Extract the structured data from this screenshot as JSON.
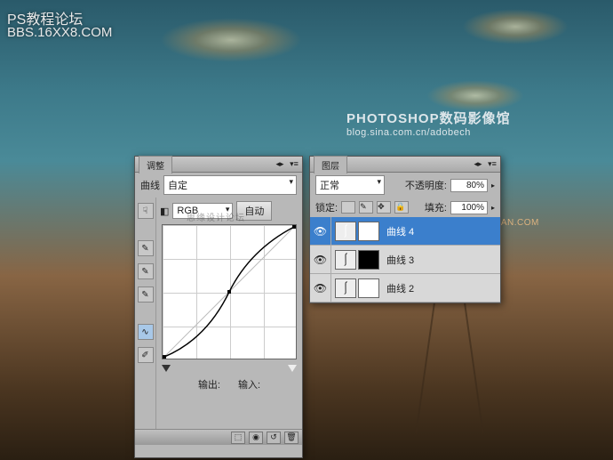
{
  "watermark": {
    "line1_a": "PS",
    "line1_b": "教程论坛",
    "line2_a": "BBS.16",
    "line2_b": "XX",
    "line2_c": "8.COM"
  },
  "centerlogo": {
    "line1": "PHOTOSHOP数码影像馆",
    "line2": "blog.sina.com.cn/adobech"
  },
  "missyuan": "WWW.MISSYUAN.COM",
  "faint_wm": "思缘设计论坛",
  "adjustments": {
    "panel_title": "调整",
    "type_label": "曲线",
    "preset": "自定",
    "channel": "RGB",
    "auto_btn": "自动",
    "output_label": "输出:",
    "input_label": "输入:"
  },
  "layers": {
    "panel_title": "图层",
    "blend_mode": "正常",
    "opacity_label": "不透明度:",
    "opacity_value": "80%",
    "lock_label": "锁定:",
    "fill_label": "填充:",
    "fill_value": "100%",
    "items": [
      {
        "name": "曲线 4",
        "mask": "white",
        "selected": true
      },
      {
        "name": "曲线 3",
        "mask": "black",
        "selected": false
      },
      {
        "name": "曲线 2",
        "mask": "white",
        "selected": false
      }
    ]
  }
}
